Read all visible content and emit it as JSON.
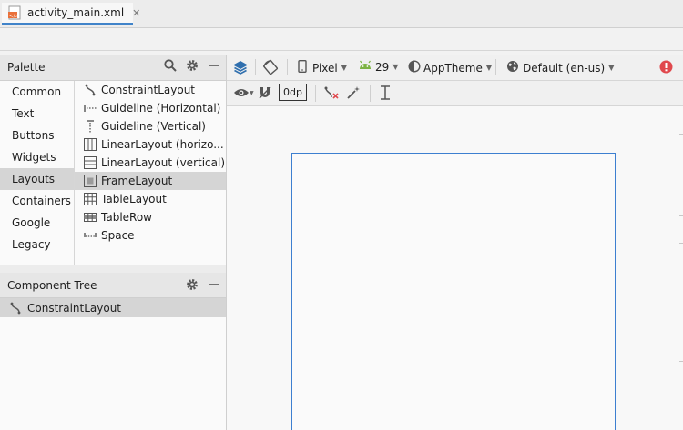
{
  "editor_tab": {
    "filename": "activity_main.xml",
    "close_glyph": "✕",
    "icon": "xml-file-icon"
  },
  "palette": {
    "title": "Palette",
    "categories": [
      "Common",
      "Text",
      "Buttons",
      "Widgets",
      "Layouts",
      "Containers",
      "Google",
      "Legacy"
    ],
    "selected_category": "Layouts",
    "items": [
      {
        "label": "ConstraintLayout",
        "icon": "constraint-layout-icon"
      },
      {
        "label": "Guideline (Horizontal)",
        "icon": "guideline-horizontal-icon"
      },
      {
        "label": "Guideline (Vertical)",
        "icon": "guideline-vertical-icon"
      },
      {
        "label": "LinearLayout (horizo...",
        "icon": "linear-layout-horizontal-icon"
      },
      {
        "label": "LinearLayout (vertical)",
        "icon": "linear-layout-vertical-icon"
      },
      {
        "label": "FrameLayout",
        "icon": "frame-layout-icon"
      },
      {
        "label": "TableLayout",
        "icon": "table-layout-icon"
      },
      {
        "label": "TableRow",
        "icon": "table-row-icon"
      },
      {
        "label": "Space",
        "icon": "space-icon"
      }
    ],
    "selected_item": "FrameLayout"
  },
  "component_tree": {
    "title": "Component Tree",
    "root": "ConstraintLayout"
  },
  "toolbar": {
    "device": "Pixel",
    "api": "29",
    "theme": "AppTheme",
    "locale": "Default (en-us)",
    "margin": "0dp"
  },
  "colors": {
    "accent": "#4083c9",
    "selection": "#d5d5d5",
    "android_green": "#7cb342",
    "error_red": "#e0484d",
    "blueprint_blue": "#3d7fd0"
  }
}
